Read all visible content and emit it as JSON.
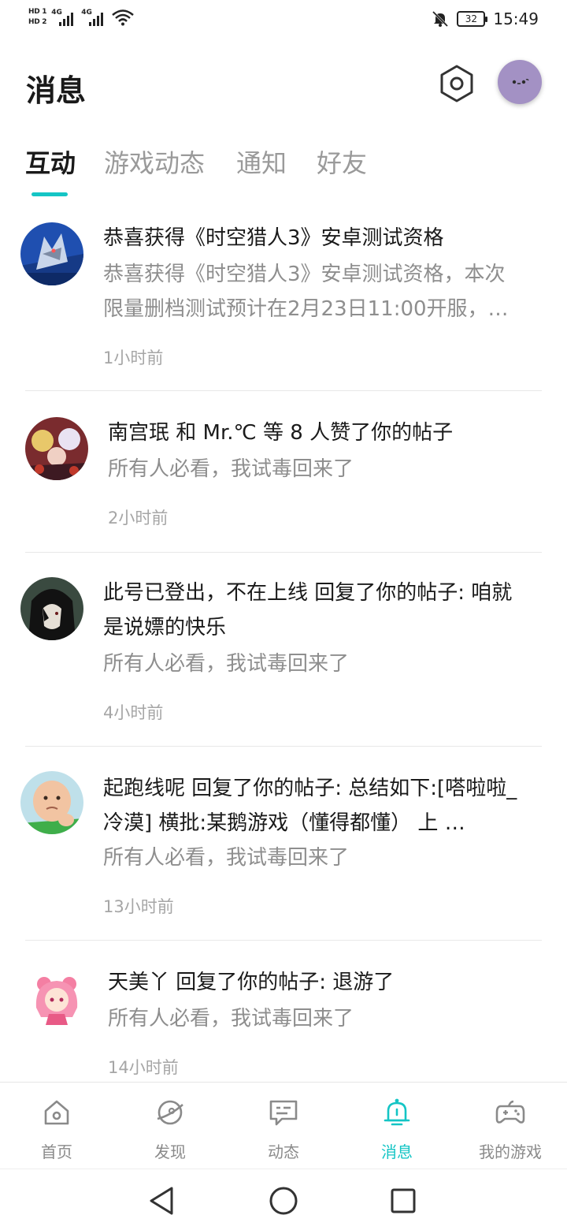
{
  "status_bar": {
    "hd1": "HD 1",
    "hd2": "HD 2",
    "sig1_net": "4G",
    "sig2_net": "4G",
    "battery": "32",
    "time": "15:49"
  },
  "header": {
    "title": "消息"
  },
  "tabs": [
    "互动",
    "游戏动态",
    "通知",
    "好友"
  ],
  "messages": [
    {
      "title": "恭喜获得《时空猎人3》安卓测试资格",
      "body_line1": "恭喜获得《时空猎人3》安卓测试资格，本次",
      "body_line2": "限量删档测试预计在2月23日11:00开服，…",
      "time": "1小时前"
    },
    {
      "title": "南宫珉 和 Mr.℃ 等 8 人赞了你的帖子",
      "body": "所有人必看，我试毒回来了",
      "time": "2小时前"
    },
    {
      "title_line1": "此号已登出，不在上线 回复了你的帖子: 咱就",
      "title_line2": "是说嫖的快乐",
      "body": "所有人必看，我试毒回来了",
      "time": "4小时前"
    },
    {
      "title_line1": "起跑线呢 回复了你的帖子: 总结如下:[嗒啦啦_",
      "title_line2": "冷漠] 横批:某鹅游戏（懂得都懂）   上    …",
      "body": "所有人必看，我试毒回来了",
      "time": "13小时前"
    },
    {
      "title": "天美丫 回复了你的帖子: 退游了",
      "body": "所有人必看，我试毒回来了",
      "time": "14小时前"
    }
  ],
  "bottom_nav": [
    {
      "label": "首页",
      "icon": "home-icon"
    },
    {
      "label": "发现",
      "icon": "discover-icon"
    },
    {
      "label": "动态",
      "icon": "feed-icon"
    },
    {
      "label": "消息",
      "icon": "bell-icon"
    },
    {
      "label": "我的游戏",
      "icon": "gamepad-icon"
    }
  ],
  "colors": {
    "accent": "#14c5c5",
    "text_primary": "#1a1a1a",
    "text_secondary": "#8e8e8e",
    "avatar_bg": "#a391c4"
  }
}
